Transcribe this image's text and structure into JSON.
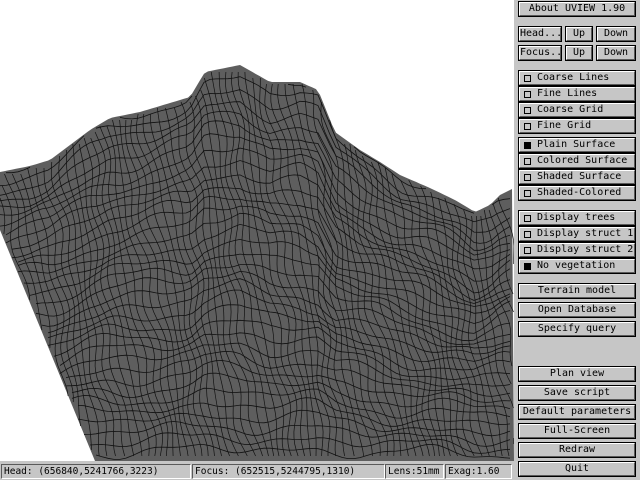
{
  "buttons": {
    "about": "About UVIEW 1.90",
    "head": "Head...",
    "up": "Up",
    "down": "Down",
    "focus": "Focus...",
    "terrain_model": "Terrain model",
    "open_database": "Open Database",
    "specify_query": "Specify query",
    "plan_view": "Plan view",
    "save_script": "Save script",
    "default_parameters": "Default parameters",
    "full_screen": "Full-Screen",
    "redraw": "Redraw",
    "quit": "Quit"
  },
  "options": {
    "lines": [
      {
        "label": "Coarse Lines",
        "selected": false
      },
      {
        "label": "Fine Lines",
        "selected": false
      },
      {
        "label": "Coarse Grid",
        "selected": false
      },
      {
        "label": "Fine Grid",
        "selected": false
      }
    ],
    "surfaces": [
      {
        "label": "Plain Surface",
        "selected": true
      },
      {
        "label": "Colored Surface",
        "selected": false
      },
      {
        "label": "Shaded Surface",
        "selected": false
      },
      {
        "label": "Shaded-Colored",
        "selected": false
      }
    ],
    "display": [
      {
        "label": "Display trees",
        "selected": false
      },
      {
        "label": "Display struct 1",
        "selected": false
      },
      {
        "label": "Display struct 2",
        "selected": false
      },
      {
        "label": "No vegetation",
        "selected": true
      }
    ]
  },
  "status": {
    "head": "Head: (656840,5241766,3223)",
    "focus": "Focus: (652515,5244795,1310)",
    "lens": "Lens:51mm",
    "exag": "Exag:1.60"
  },
  "colors": {
    "terrain_fill": "#5e5e5e",
    "mesh_line": "#111111",
    "panel": "#c6c6c6"
  }
}
